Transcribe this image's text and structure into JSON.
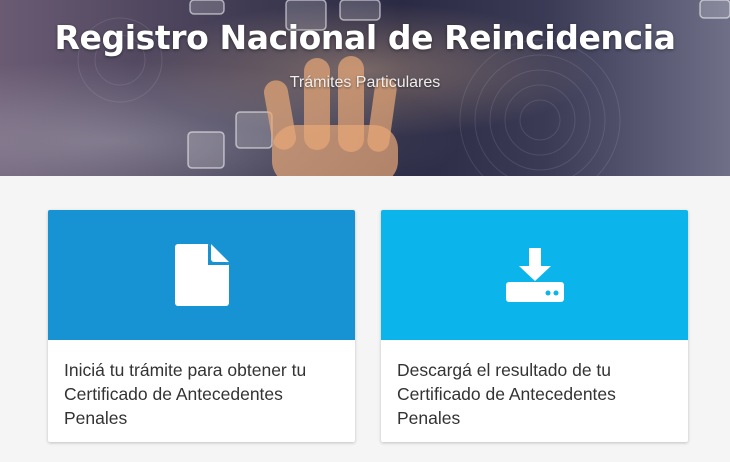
{
  "hero": {
    "title": "Registro Nacional de Reincidencia",
    "subtitle": "Trámites Particulares"
  },
  "cards": [
    {
      "icon": "document-icon",
      "color": "#1793d4",
      "text": "Iniciá tu trámite para obtener tu Certificado de Antecedentes Penales"
    },
    {
      "icon": "download-icon",
      "color": "#0cb4ec",
      "text": "Descargá el resultado de tu Certificado de Antecedentes Penales"
    }
  ]
}
